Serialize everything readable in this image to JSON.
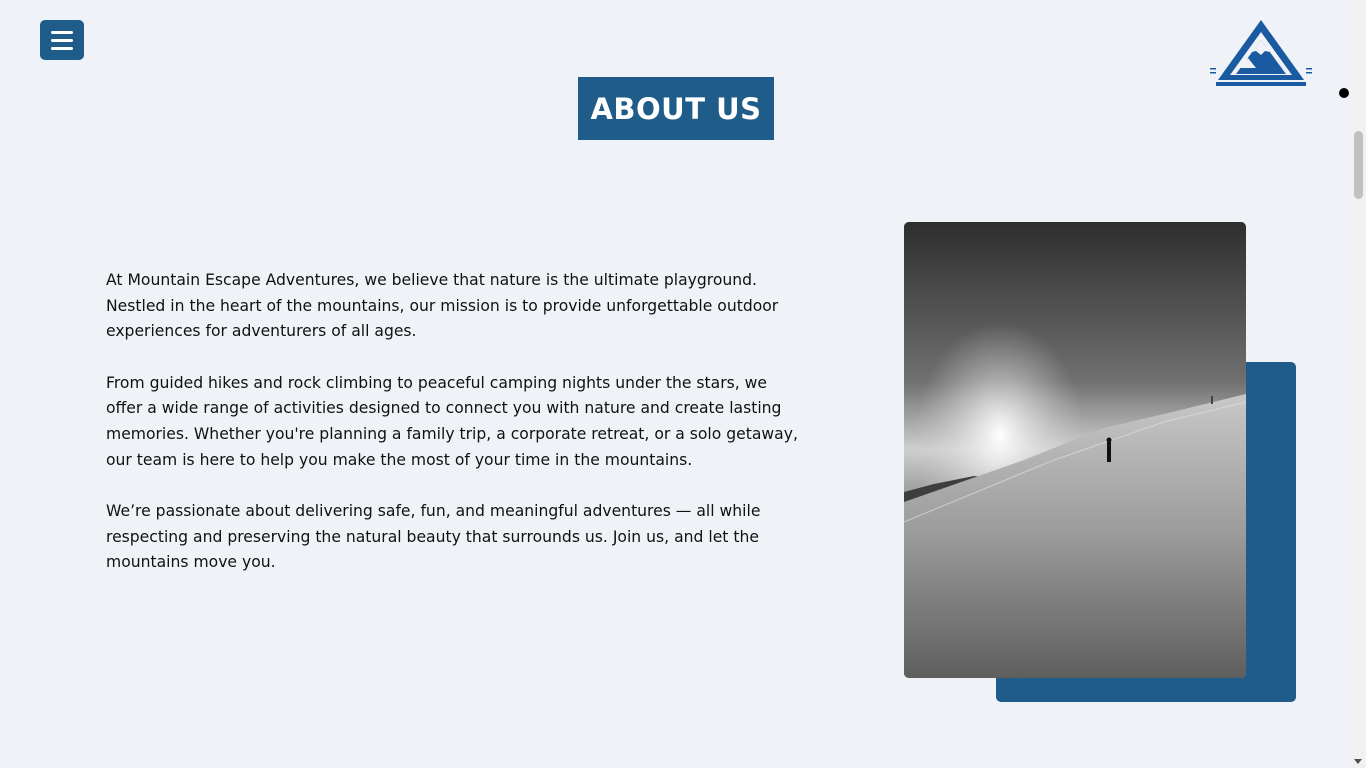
{
  "header": {
    "menu_icon": "hamburger-icon",
    "logo_icon": "mountain-logo-icon"
  },
  "section": {
    "title": "ABOUT US",
    "paragraphs": [
      "At Mountain Escape Adventures, we believe that nature is the ultimate playground. Nestled in the heart of the mountains, our mission is to provide unforgettable outdoor experiences for adventurers of all ages.",
      "From guided hikes and rock climbing to peaceful camping nights under the stars, we offer a wide range of activities designed to connect you with nature and create lasting memories. Whether you're planning a family trip, a corporate retreat, or a solo getaway, our team is here to help you make the most of your time in the mountains.",
      "We’re passionate about delivering safe, fun, and meaningful adventures — all while respecting and preserving the natural beauty that surrounds us. Join us, and let the mountains move you."
    ]
  },
  "colors": {
    "accent": "#1f5c89",
    "background": "#eff3f8"
  }
}
